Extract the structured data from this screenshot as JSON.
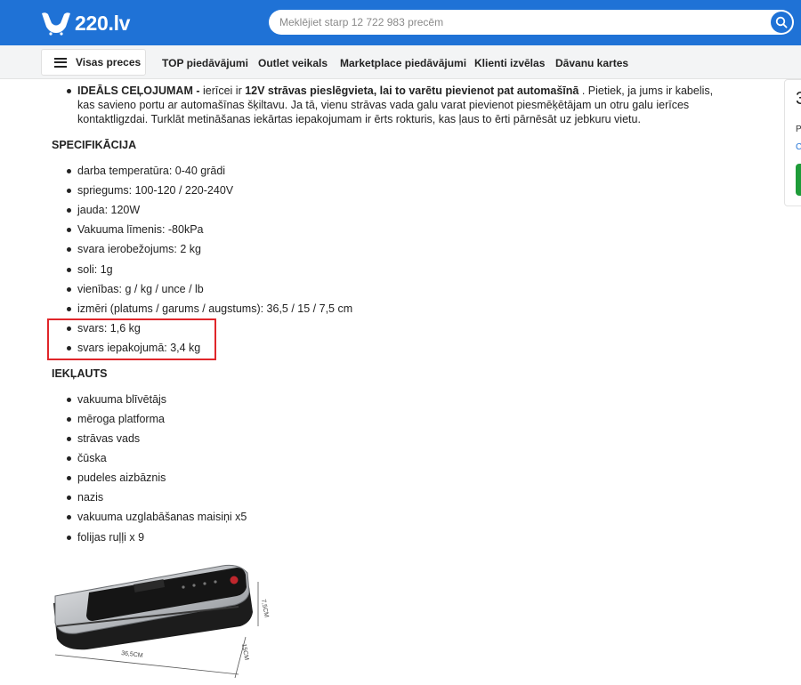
{
  "header": {
    "logo_text": "220.lv",
    "search_placeholder": "Meklējiet starp 12 722 983 precēm"
  },
  "nav": {
    "menu_label": "Visas preces",
    "items": [
      "TOP piedāvājumi",
      "Outlet veikals",
      "Marketplace piedāvājumi",
      "Klienti izvēlas",
      "Dāvanu kartes"
    ]
  },
  "side_card": {
    "price_fragment": "3",
    "p_fragment": "P",
    "o_fragment": "C"
  },
  "content": {
    "ideal": {
      "bold_lead": "IDEĀLS CEĻOJUMAM -",
      "text_1": " ierīcei ir ",
      "bold_2": "12V strāvas pieslēgvieta, lai to varētu pievienot pat automašīnā",
      "text_2": " . Pietiek, ja jums ir kabelis, kas savieno portu ar automašīnas šķiltavu. Ja tā, vienu strāvas vada galu varat pievienot piesmēķētājam un otru galu ierīces kontaktligzdai. Turklāt metināšanas iekārtas iepakojumam ir ērts rokturis, kas ļaus to ērti pārnēsāt uz jebkuru vietu."
    },
    "spec_title": "SPECIFIKĀCIJA",
    "spec_items": [
      "darba temperatūra: 0-40 grādi",
      "spriegums: 100-120 / 220-240V",
      "jauda: 120W",
      "Vakuuma līmenis: -80kPa",
      "svara ierobežojums: 2 kg",
      "soli: 1g",
      "vienības: g / kg / unce / lb",
      "izmēri (platums / garums / augstums): 36,5 / 15 / 7,5 cm",
      "svars: 1,6 kg",
      "svars iepakojumā: 3,4 kg"
    ],
    "incl_title": "IEKĻAUTS",
    "incl_items": [
      "vakuuma blīvētājs",
      "mēroga platforma",
      "strāvas vads",
      "čūska",
      "pudeles aizbāznis",
      "nazis",
      "vakuuma uzglabāšanas maisiņi x5",
      "folijas ruļļi x 9"
    ]
  },
  "image": {
    "dim_width": "36,5CM",
    "dim_depth": "15CM",
    "dim_height": "7,5CM"
  },
  "colors": {
    "brand_blue": "#1f72d6",
    "highlight_red": "#e0262a",
    "buy_green": "#1e9c39"
  }
}
